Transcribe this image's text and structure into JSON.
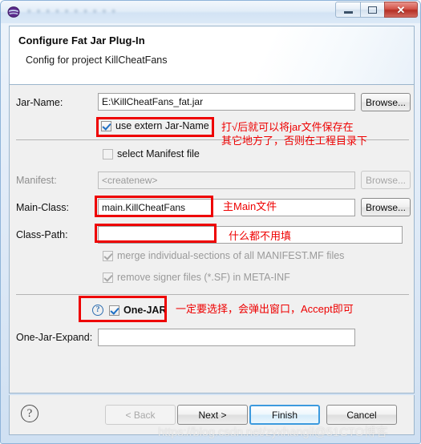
{
  "window": {
    "icon": "eclipse-globe-icon",
    "title_ghost": "● ● ● ● ● ● ● ● ● ●",
    "minimize_label": "–",
    "maximize_label": "□",
    "close_label": "✕"
  },
  "header": {
    "title": "Configure Fat Jar Plug-In",
    "subtitle": "Config for project KillCheatFans"
  },
  "form": {
    "jar_name": {
      "label": "Jar-Name:",
      "value": "E:\\KillCheatFans_fat.jar",
      "browse": "Browse..."
    },
    "use_extern": {
      "label": "use extern Jar-Name",
      "checked": true
    },
    "select_manifest": {
      "label": "select Manifest file",
      "checked": false
    },
    "manifest": {
      "label": "Manifest:",
      "value": "<createnew>",
      "browse": "Browse..."
    },
    "main_class": {
      "label": "Main-Class:",
      "value": "main.KillCheatFans",
      "browse": "Browse..."
    },
    "class_path": {
      "label": "Class-Path:",
      "value": "",
      "browse": ""
    },
    "merge_sections": {
      "label": "merge individual-sections of all MANIFEST.MF files",
      "checked": true
    },
    "remove_signer": {
      "label": "remove signer files (*.SF) in META-INF",
      "checked": true
    },
    "one_jar": {
      "help": "?",
      "label": "One-JAR",
      "checked": true
    },
    "one_jar_expand": {
      "label": "One-Jar-Expand:",
      "value": ""
    }
  },
  "annotations": {
    "jar_name_line1": "打√后就可以将jar文件保存在",
    "jar_name_line2": "其它地方了，否则在工程目录下",
    "main_class": "主Main文件",
    "class_path": "什么都不用填",
    "one_jar": "一定要选择，会弹出窗口，Accept即可",
    "color": "#ee0000"
  },
  "footer": {
    "help": "?",
    "back": "< Back",
    "next": "Next >",
    "finish": "Finish",
    "cancel": "Cancel"
  },
  "watermark": "https://blog.csdn.net/zyxhangil@51CTO博客"
}
